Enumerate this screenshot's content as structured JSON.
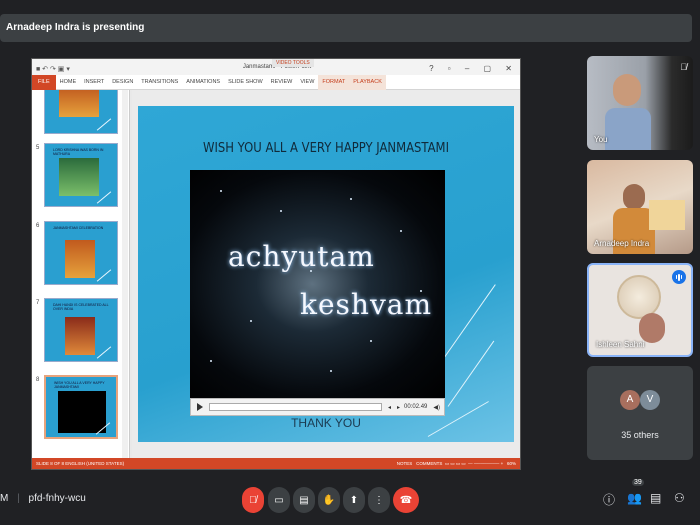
{
  "meet": {
    "presenting_banner": "Arnadeep Indra is presenting",
    "meeting_code": "pfd-fnhy-wcu",
    "time_fragment": "M",
    "participant_badge": "39",
    "others_label": "35 others",
    "tiles": [
      {
        "name": "You"
      },
      {
        "name": "Arnadeep Indra"
      },
      {
        "name": "Ishleen Sahni"
      },
      {
        "name": "35 others",
        "avatars": [
          "A",
          "V"
        ]
      }
    ]
  },
  "ppt": {
    "window_title": "Janmastami - PowerPoint",
    "context_tab": "VIDEO TOOLS",
    "tabs": [
      "FILE",
      "HOME",
      "INSERT",
      "DESIGN",
      "TRANSITIONS",
      "ANIMATIONS",
      "SLIDE SHOW",
      "REVIEW",
      "VIEW",
      "FORMAT",
      "PLAYBACK"
    ],
    "slide_title": "WISH YOU ALL A VERY HAPPY JANMASTAMI",
    "video_text_1": "achyutam",
    "video_text_2": "keshvam",
    "video_time": "00:02.49",
    "behind_text": "THANK YOU",
    "status_left": "SLIDE 8 OF 8     ENGLISH (UNITED STATES)",
    "status_notes": "NOTES",
    "status_comments": "COMMENTS",
    "zoom": "60%",
    "thumbnails": [
      {
        "num": "",
        "text": ""
      },
      {
        "num": "5",
        "text": "LORD KRISHNA WAS BORN IN MATHURA"
      },
      {
        "num": "6",
        "text": "JANMASHTAMI CELEBRATION"
      },
      {
        "num": "7",
        "text": "DAHI HANDI IS CELEBRATED ALL OVER INDIA"
      },
      {
        "num": "8",
        "text": "WISH YOU ALL A VERY HAPPY JANMASHTAMI"
      }
    ]
  },
  "colors": {
    "ppt_accent": "#d24726",
    "meet_bg": "#202124",
    "leave_red": "#ea4335",
    "speaking_blue": "#1a73e8"
  }
}
